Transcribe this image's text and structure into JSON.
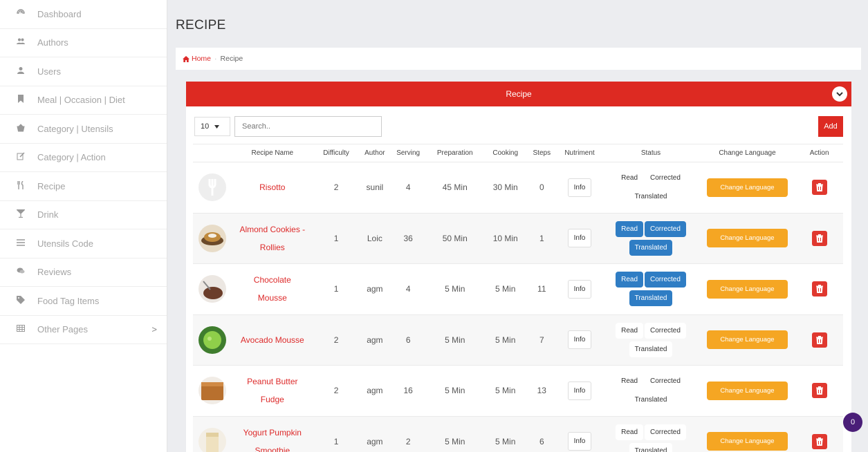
{
  "sidebar": {
    "items": [
      {
        "label": "Dashboard",
        "icon": "dashboard-icon"
      },
      {
        "label": "Authors",
        "icon": "users-group-icon"
      },
      {
        "label": "Users",
        "icon": "user-icon"
      },
      {
        "label": "Meal | Occasion | Diet",
        "icon": "bookmark-icon"
      },
      {
        "label": "Category | Utensils",
        "icon": "basket-icon"
      },
      {
        "label": "Category | Action",
        "icon": "edit-icon"
      },
      {
        "label": "Recipe",
        "icon": "cutlery-icon"
      },
      {
        "label": "Drink",
        "icon": "cocktail-icon"
      },
      {
        "label": "Utensils Code",
        "icon": "list-icon"
      },
      {
        "label": "Reviews",
        "icon": "comments-icon"
      },
      {
        "label": "Food Tag Items",
        "icon": "tag-icon"
      },
      {
        "label": "Other Pages",
        "icon": "table-icon",
        "chevron": ">"
      }
    ]
  },
  "page": {
    "title": "RECIPE",
    "breadcrumb": {
      "home": "Home",
      "current": "Recipe"
    }
  },
  "panel": {
    "title": "Recipe",
    "page_size": "10",
    "search_placeholder": "Search..",
    "add_label": "Add"
  },
  "table": {
    "headers": [
      "",
      "Recipe Name",
      "Difficulty",
      "Author",
      "Serving",
      "Preparation",
      "Cooking",
      "Steps",
      "Nutriment",
      "Status",
      "Change Language",
      "Action"
    ],
    "rows": [
      {
        "name": [
          "Risotto"
        ],
        "difficulty": "2",
        "author": "sunil",
        "serving": "4",
        "preparation": "45 Min",
        "cooking": "30 Min",
        "steps": "0",
        "nutriment": "Info",
        "status": {
          "read": false,
          "corrected": false,
          "translated": false
        },
        "thumb": "placeholder"
      },
      {
        "name": [
          "Almond Cookies -",
          "Rollies"
        ],
        "difficulty": "1",
        "author": "Loic",
        "serving": "36",
        "preparation": "50 Min",
        "cooking": "10 Min",
        "steps": "1",
        "nutriment": "Info",
        "status": {
          "read": true,
          "corrected": true,
          "translated": true
        },
        "thumb": "cookies"
      },
      {
        "name": [
          "Chocolate",
          "Mousse"
        ],
        "difficulty": "1",
        "author": "agm",
        "serving": "4",
        "preparation": "5 Min",
        "cooking": "5 Min",
        "steps": "11",
        "nutriment": "Info",
        "status": {
          "read": true,
          "corrected": true,
          "translated": true
        },
        "thumb": "chocolate"
      },
      {
        "name": [
          "Avocado Mousse"
        ],
        "difficulty": "2",
        "author": "agm",
        "serving": "6",
        "preparation": "5 Min",
        "cooking": "5 Min",
        "steps": "7",
        "nutriment": "Info",
        "status": {
          "read": false,
          "corrected": false,
          "translated": false
        },
        "thumb": "avocado"
      },
      {
        "name": [
          "Peanut Butter",
          "Fudge"
        ],
        "difficulty": "2",
        "author": "agm",
        "serving": "16",
        "preparation": "5 Min",
        "cooking": "5 Min",
        "steps": "13",
        "nutriment": "Info",
        "status": {
          "read": false,
          "corrected": false,
          "translated": false
        },
        "thumb": "fudge"
      },
      {
        "name": [
          "Yogurt Pumpkin",
          "Smoothie"
        ],
        "difficulty": "1",
        "author": "agm",
        "serving": "2",
        "preparation": "5 Min",
        "cooking": "5 Min",
        "steps": "6",
        "nutriment": "Info",
        "status": {
          "read": false,
          "corrected": false,
          "translated": false
        },
        "thumb": "smoothie"
      }
    ],
    "status_labels": {
      "read": "Read",
      "corrected": "Corrected",
      "translated": "Translated"
    },
    "change_language_label": "Change Language"
  },
  "notification_count": "0",
  "colors": {
    "accent": "#dd2a22",
    "status_active": "#2f7dc4",
    "language_button": "#f5a623",
    "badge": "#4a1e78"
  }
}
